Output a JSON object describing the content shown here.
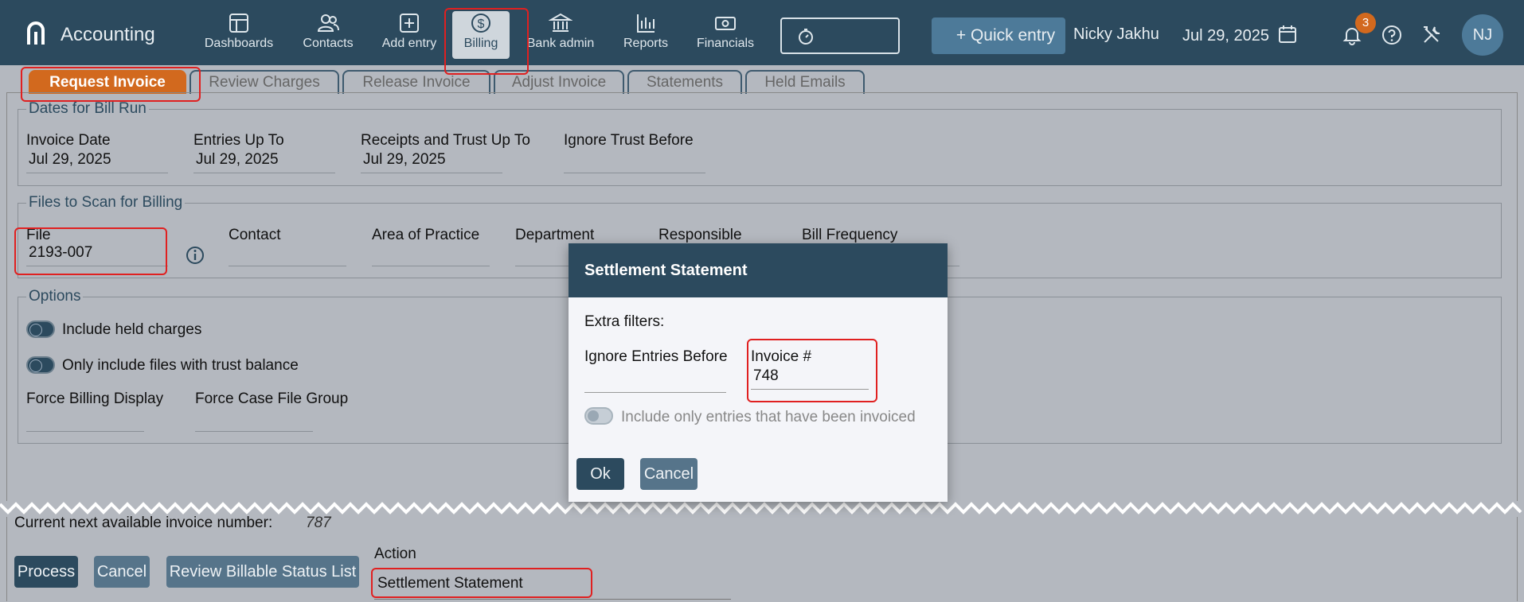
{
  "header": {
    "app_title": "Accounting",
    "nav": [
      {
        "label": "Dashboards",
        "icon": "dashboard-icon"
      },
      {
        "label": "Contacts",
        "icon": "contacts-icon"
      },
      {
        "label": "Add entry",
        "icon": "add-entry-icon"
      },
      {
        "label": "Billing",
        "icon": "dollar-icon"
      },
      {
        "label": "Bank admin",
        "icon": "bank-icon"
      },
      {
        "label": "Reports",
        "icon": "bar-chart-icon"
      },
      {
        "label": "Financials",
        "icon": "money-icon"
      }
    ],
    "quick_entry": "+ Quick entry",
    "user_name": "Nicky Jakhu",
    "date": "Jul 29, 2025",
    "notification_count": "3",
    "avatar_initials": "NJ"
  },
  "tabs": [
    "Request Invoice",
    "Review Charges",
    "Release Invoice",
    "Adjust Invoice",
    "Statements",
    "Held Emails"
  ],
  "dates_section": {
    "legend": "Dates for Bill Run",
    "invoice_date_label": "Invoice Date",
    "invoice_date": "Jul 29, 2025",
    "entries_up_to_label": "Entries Up To",
    "entries_up_to": "Jul 29, 2025",
    "receipts_label": "Receipts and Trust Up To",
    "receipts": "Jul 29, 2025",
    "ignore_trust_label": "Ignore Trust Before",
    "ignore_trust": ""
  },
  "files_section": {
    "legend": "Files to Scan for Billing",
    "file_label": "File",
    "file_value": "2193-007",
    "contact_label": "Contact",
    "area_label": "Area of Practice",
    "department_label": "Department",
    "responsible_label": "Responsible",
    "frequency_label": "Bill Frequency"
  },
  "options_section": {
    "legend": "Options",
    "include_held": "Include held charges",
    "only_trust": "Only include files with trust balance",
    "force_billing_label": "Force Billing Display",
    "force_case_label": "Force Case File Group"
  },
  "bottom": {
    "next_invoice_label": "Current next available invoice number:",
    "next_invoice_number": "787",
    "process": "Process",
    "cancel": "Cancel",
    "review_status": "Review Billable Status List",
    "action_label": "Action",
    "action_value": "Settlement Statement"
  },
  "modal": {
    "title": "Settlement Statement",
    "extra_filters": "Extra filters:",
    "ignore_entries_label": "Ignore Entries Before",
    "ignore_entries_value": "",
    "invoice_no_label": "Invoice #",
    "invoice_no_value": "748",
    "only_invoiced": "Include only entries that have been invoiced",
    "ok": "Ok",
    "cancel": "Cancel"
  },
  "colors": {
    "header_bg": "#2c4a5e",
    "active_tab": "#d2691e",
    "highlight": "#e02020"
  }
}
